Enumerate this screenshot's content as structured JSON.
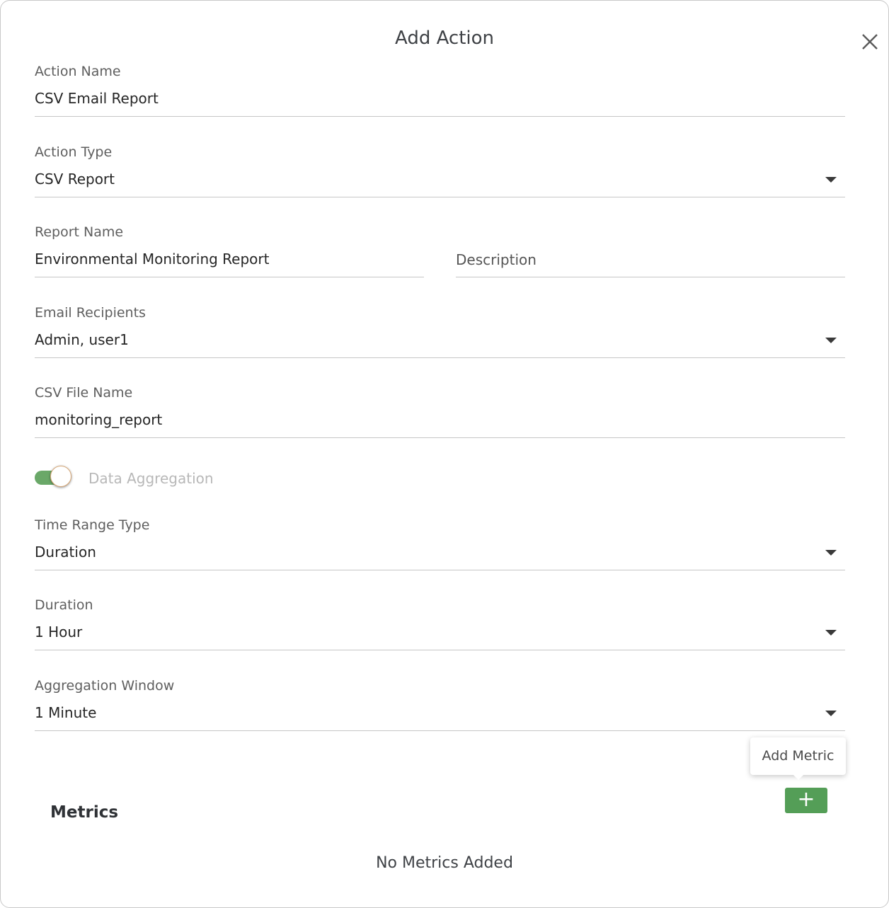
{
  "dialog": {
    "title": "Add Action",
    "close_icon": "close-icon"
  },
  "fields": {
    "action_name": {
      "label": "Action Name",
      "value": "CSV Email Report"
    },
    "action_type": {
      "label": "Action Type",
      "value": "CSV Report"
    },
    "report_name": {
      "label": "Report Name",
      "value": "Environmental Monitoring Report"
    },
    "description": {
      "placeholder": "Description"
    },
    "email_recipients": {
      "label": "Email Recipients",
      "value": "Admin, user1"
    },
    "csv_file_name": {
      "label": "CSV File Name",
      "value": "monitoring_report"
    },
    "data_aggregation": {
      "label": "Data Aggregation",
      "enabled": true
    },
    "time_range_type": {
      "label": "Time Range Type",
      "value": "Duration"
    },
    "duration": {
      "label": "Duration",
      "value": "1 Hour"
    },
    "aggregation_window": {
      "label": "Aggregation Window",
      "value": "1 Minute"
    }
  },
  "metrics": {
    "heading": "Metrics",
    "add_tooltip": "Add Metric",
    "add_button_label": "+",
    "empty_message": "No Metrics Added"
  },
  "colors": {
    "accent_green": "#549e57",
    "toggle_track": "#6aa868"
  }
}
